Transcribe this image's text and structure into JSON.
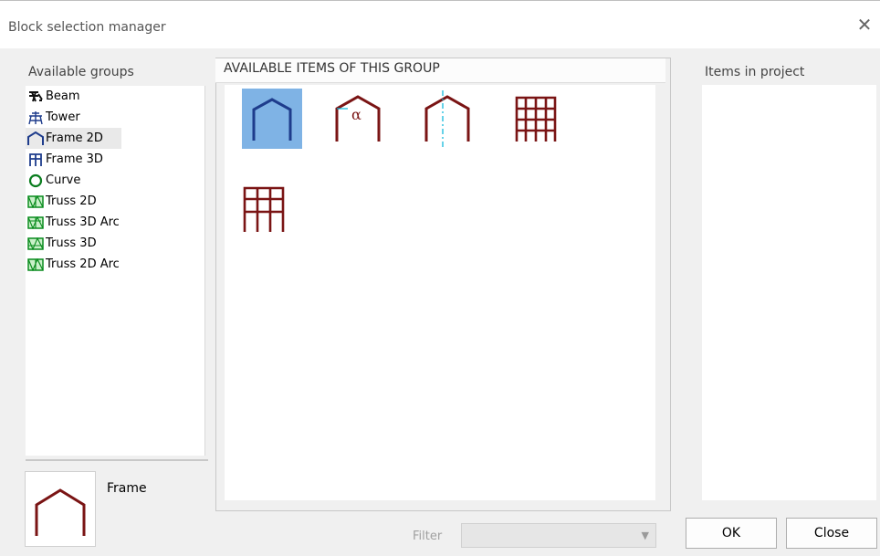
{
  "window": {
    "title": "Block selection manager",
    "close_icon": "close-icon"
  },
  "groups": {
    "header": "Available groups",
    "items": [
      {
        "label": "Beam",
        "icon": "beam-icon"
      },
      {
        "label": "Tower",
        "icon": "tower-icon"
      },
      {
        "label": "Frame 2D",
        "icon": "frame-2d-icon",
        "selected": true
      },
      {
        "label": "Frame 3D",
        "icon": "frame-3d-icon"
      },
      {
        "label": "Curve",
        "icon": "curve-icon"
      },
      {
        "label": "Truss 2D",
        "icon": "truss-2d-icon"
      },
      {
        "label": "Truss 3D Arc",
        "icon": "truss-3d-arc-icon"
      },
      {
        "label": "Truss 3D",
        "icon": "truss-3d-icon"
      },
      {
        "label": "Truss 2D Arc",
        "icon": "truss-2d-arc-icon"
      }
    ]
  },
  "preview": {
    "label": "Frame",
    "icon": "frame-preview-icon"
  },
  "available_items": {
    "header": "AVAILABLE ITEMS OF THIS GROUP",
    "items": [
      {
        "icon": "portal-frame-icon",
        "selected": true
      },
      {
        "icon": "pitched-frame-angle-icon",
        "symbol": "α"
      },
      {
        "icon": "pitched-frame-axis-icon"
      },
      {
        "icon": "multi-bay-frame-icon"
      },
      {
        "icon": "multi-storey-frame-icon"
      }
    ]
  },
  "project": {
    "header": "Items in project"
  },
  "filter": {
    "label": "Filter",
    "value": ""
  },
  "buttons": {
    "ok": "OK",
    "close": "Close"
  },
  "colors": {
    "frame": "#7a1414",
    "selected_frame": "#1e3c8c",
    "selection": "#7fb3e5",
    "accent_cyan": "#00b4d8"
  }
}
